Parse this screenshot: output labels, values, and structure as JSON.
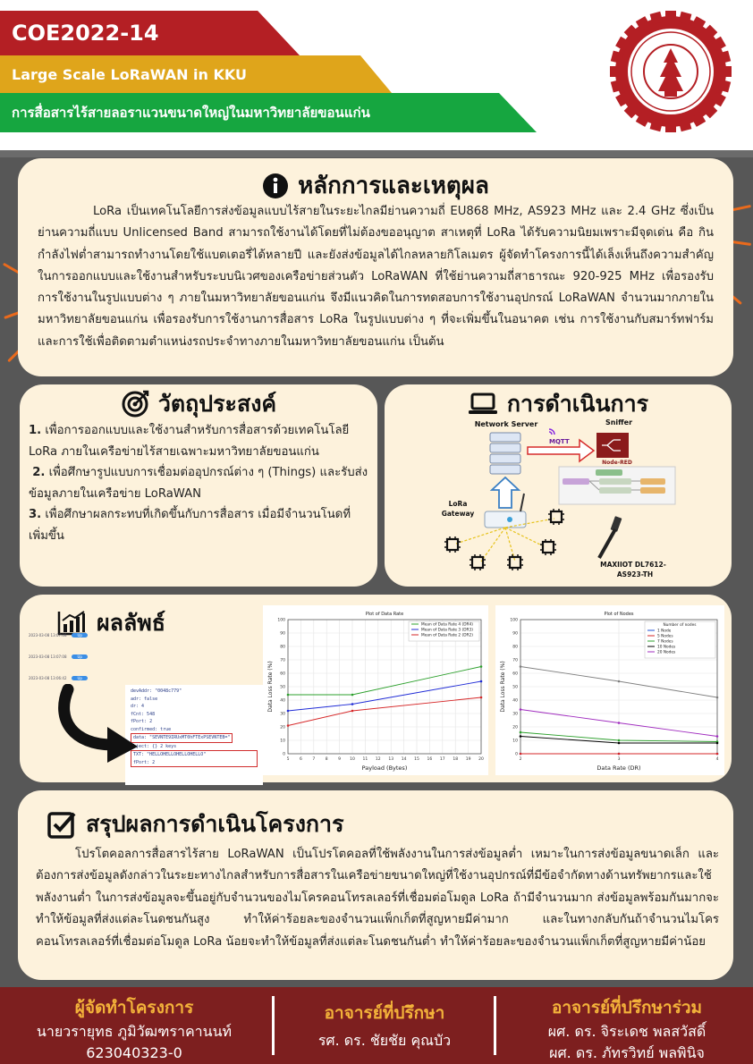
{
  "header": {
    "code": "COE2022-14",
    "title_en": "Large Scale LoRaWAN in KKU",
    "title_th": "การสื่อสารไร้สายลอราแวนขนาดใหญ่ในมหาวิทยาลัยขอนแก่น"
  },
  "colors": {
    "red": "#b41f24",
    "yellow": "#dfa51b",
    "green": "#16a640",
    "panel": "#fdf2dc",
    "footer": "#7d1f1f",
    "footer_head": "#f3b23a",
    "accent": "#ea6a1c"
  },
  "rationale": {
    "icon": "info-icon",
    "title": "หลักการและเหตุผล",
    "body": "LoRa เป็นเทคโนโลยีการส่งข้อมูลแบบไร้สายในระยะไกลมีย่านความถี่ EU868 MHz, AS923 MHz และ 2.4 GHz ซึ่งเป็นย่านความถี่แบบ Unlicensed Band สามารถใช้งานได้โดยที่ไม่ต้องขออนุญาต สาเหตุที่ LoRa ได้รับความนิยมเพราะมีจุดเด่น คือ กินกำลังไฟต่ำสามารถทำงานโดยใช้แบตเตอรี่ได้หลายปี และยังส่งข้อมูลได้ไกลหลายกิโลเมตร ผู้จัดทำโครงการนี้ได้เล็งเห็นถึงความสำคัญในการออกแบบและใช้งานสำหรับระบบนิเวศของเครือข่ายส่วนตัว LoRaWAN ที่ใช้ย่านความถี่สาธารณะ 920-925 MHz เพื่อรองรับการใช้งานในรูปแบบต่าง ๆ ภายในมหาวิทยาลัยขอนแก่น จึงมีแนวคิดในการทดสอบการใช้งานอุปกรณ์ LoRaWAN จำนวนมากภายในมหาวิทยาลัยขอนแก่น เพื่อรองรับการใช้งานการสื่อสาร LoRa ในรูปแบบต่าง ๆ ที่จะเพิ่มขึ้นในอนาคต เช่น การใช้งานกับสมาร์ทฟาร์ม และการใช้เพื่อติดตามตำแหน่งรถประจำทางภายในมหาวิทยาลัยขอนแก่น เป็นต้น"
  },
  "objectives": {
    "icon": "target-icon",
    "title": "วัตถุประสงค์",
    "items": [
      {
        "num": "1.",
        "text": "เพื่อการออกแบบและใช้งานสำหรับการสื่อสารด้วยเทคโนโลยี LoRa ภายในเครือข่ายไร้สายเฉพาะมหาวิทยาลัยขอนแก่น"
      },
      {
        "num": "2.",
        "text": "เพื่อศึกษารูปแบบการเชื่อมต่ออุปกรณ์ต่าง ๆ (Things) และรับส่งข้อมูลภายในเครือข่าย LoRaWAN"
      },
      {
        "num": "3.",
        "text": "เพื่อศึกษาผลกระทบที่เกิดขึ้นกับการสื่อสาร เมื่อมีจำนวนโนดที่เพิ่มขึ้น"
      }
    ]
  },
  "method": {
    "icon": "laptop-icon",
    "title": "การดำเนินการ",
    "network_server": "Network Server",
    "mqtt": "MQTT",
    "sniffer": "Sniffer",
    "node_red": "Node-RED",
    "gateway": "LoRa\nGateway",
    "gateway_l1": "LoRa",
    "gateway_l2": "Gateway",
    "device_l1": "MAXIIOT DL7612-",
    "device_l2": "AS923-TH"
  },
  "results": {
    "icon": "chart-icon",
    "title": "ผลลัพธ์",
    "log_rows": [
      {
        "time": "2023-03-08 13:07:08",
        "tag": "Up"
      },
      {
        "time": "2023-03-08 13:07:08",
        "tag": "Up"
      },
      {
        "time": "2023-03-08 13:06:42",
        "tag": "Up"
      }
    ],
    "json_lines": [
      "devAddr: \"0048c779\"",
      "adr: false",
      "dr: 4",
      "fCnt: 548",
      "fPort: 2",
      "confirmed: true",
      "data: \"SEVNTE9IRUxMT0hFTExPSEVNTEB=\"",
      "object: {} 2 keys",
      "TXT: \"HELLOHELLOHELLOHELLO\"",
      "fPort: 2"
    ]
  },
  "chart_data": [
    {
      "type": "line",
      "title": "Plot of Data Rate",
      "xlabel": "Payload (Bytes)",
      "ylabel": "Data Loss Rate (%)",
      "ylim": [
        0,
        100
      ],
      "xlim": [
        5,
        20
      ],
      "x_ticks": [
        5,
        6,
        7,
        8,
        9,
        10,
        11,
        12,
        13,
        14,
        15,
        16,
        17,
        18,
        19,
        20
      ],
      "y_ticks": [
        0,
        10,
        20,
        30,
        40,
        50,
        60,
        70,
        80,
        90,
        100
      ],
      "legend": "top-right",
      "x": [
        5,
        10,
        20
      ],
      "series": [
        {
          "name": "Mean of Data Rate 4 (DR4)",
          "color": "#2ca02c",
          "values": [
            44,
            44,
            65
          ]
        },
        {
          "name": "Mean of Data Rate 3 (DR3)",
          "color": "#1f2bd6",
          "values": [
            32,
            37,
            54
          ]
        },
        {
          "name": "Mean of Data Rate 2 (DR2)",
          "color": "#d62728",
          "values": [
            21,
            32,
            42
          ]
        }
      ]
    },
    {
      "type": "line",
      "title": "Plot of Nodes",
      "xlabel": "Data Rate (DR)",
      "ylabel": "Data Loss Rate (%)",
      "ylim": [
        0,
        100
      ],
      "xlim": [
        2,
        4
      ],
      "x_ticks": [
        2,
        3,
        4
      ],
      "y_ticks": [
        0,
        10,
        20,
        30,
        40,
        50,
        60,
        70,
        80,
        90,
        100
      ],
      "legend_title": "Number of nodes",
      "legend": "top-right",
      "x": [
        2,
        3,
        4
      ],
      "series": [
        {
          "name": "1 Node",
          "color": "#1f4fd6",
          "values": [
            0,
            0,
            0
          ]
        },
        {
          "name": "5 Nodes",
          "color": "#d62728",
          "values": [
            0,
            0,
            0
          ]
        },
        {
          "name": "7 Nodes",
          "color": "#2ca02c",
          "values": [
            16,
            10,
            9
          ]
        },
        {
          "name": "10 Nodes",
          "color": "#000000",
          "values": [
            13,
            8,
            8
          ]
        },
        {
          "name": "20 Nodes",
          "color": "#a02cbf",
          "values": [
            33,
            23,
            13
          ]
        },
        {
          "name": "",
          "color": "#7f7f7f",
          "values": [
            65,
            54,
            42
          ]
        }
      ]
    }
  ],
  "conclusion": {
    "icon": "checkbox-icon",
    "title": "สรุปผลการดำเนินโครงการ",
    "body": "โปรโตคอลการสื่อสารไร้สาย LoRaWAN เป็นโปรโตคอลที่ใช้พลังงานในการส่งข้อมูลต่ำ เหมาะในการส่งข้อมูลขนาดเล็ก และต้องการส่งข้อมูลดังกล่าวในระยะทางไกลสำหรับการสื่อสารในเครือข่ายขนาดใหญ่ที่ใช้งานอุปกรณ์ที่มีข้อจำกัดทางด้านทรัพยากรและใช้พลังงานต่ำ ในการส่งข้อมูลจะขึ้นอยู่กับจำนวนของไมโครคอนโทรลเลอร์ที่เชื่อมต่อโมดูล LoRa ถ้ามีจำนวนมาก ส่งข้อมูลพร้อมกันมากจะทำให้ข้อมูลที่ส่งแต่ละโนดชนกันสูง ทำให้ค่าร้อยละของจำนวนแพ็กเก็ตที่สูญหายมีค่ามาก และในทางกลับกันถ้าจำนวนไมโครคอนโทรลเลอร์ที่เชื่อมต่อโมดูล LoRa น้อยจะทำให้ข้อมูลที่ส่งแต่ละโนดชนกันต่ำ ทำให้ค่าร้อยละของจำนวนแพ็กเก็ตที่สูญหายมีค่าน้อย"
  },
  "footer": {
    "organizer_head": "ผู้จัดทำโครงการ",
    "organizer_name": "นายวรายุทธ ภูมิวัฒฑราคานนท์",
    "organizer_id": "623040323-0",
    "advisor_head": "อาจารย์ที่ปรึกษา",
    "advisor_name": "รศ. ดร. ชัยชัย คุณบัว",
    "coadvisor_head": "อาจารย์ที่ปรึกษาร่วม",
    "coadvisor_1": "ผศ. ดร. จิระเดช    พลสวัสดิ์",
    "coadvisor_2": "ผศ. ดร. ภัทรวิทย์   พลพินิจ"
  }
}
